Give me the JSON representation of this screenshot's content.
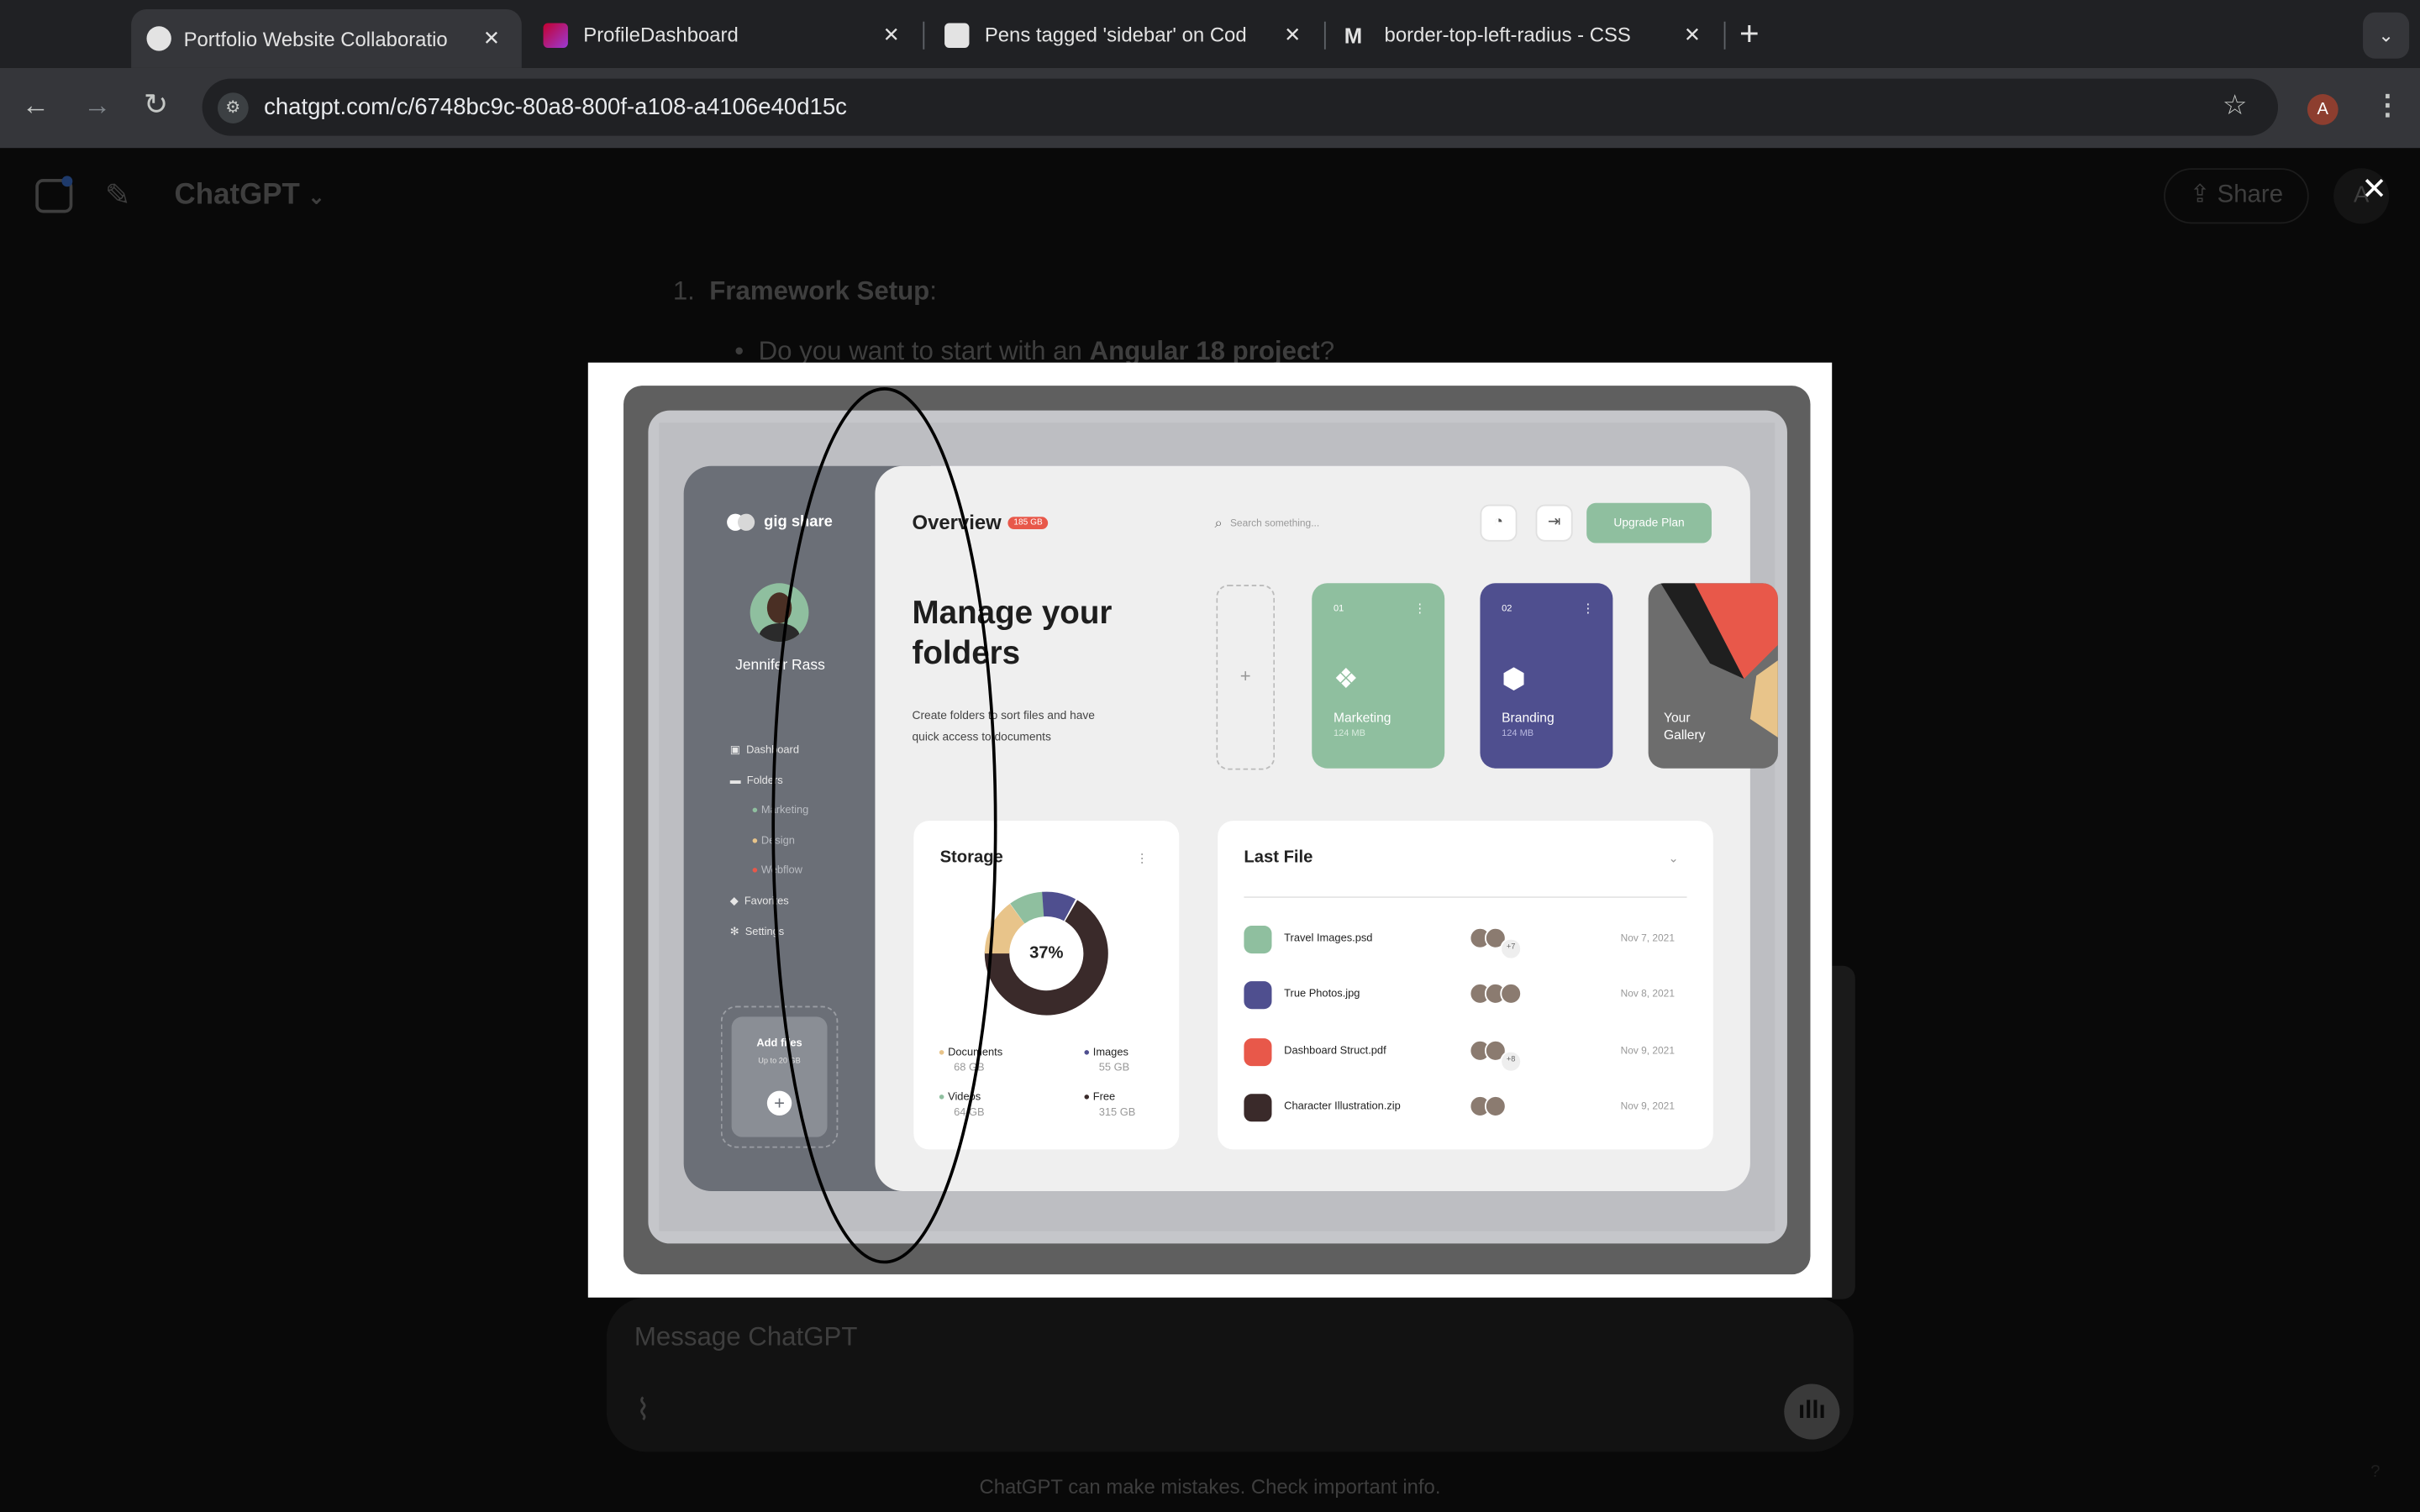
{
  "browser": {
    "tabs": [
      {
        "title": "Portfolio Website Collaboratio",
        "active": true
      },
      {
        "title": "ProfileDashboard",
        "active": false
      },
      {
        "title": "Pens tagged 'sidebar' on Cod",
        "active": false
      },
      {
        "title": "border-top-left-radius - CSS",
        "active": false
      }
    ],
    "new_tab": "+",
    "url": "chatgpt.com/c/6748bc9c-80a8-800f-a108-a4106e40d15c",
    "profile_initial": "A"
  },
  "chatgpt": {
    "title": "ChatGPT",
    "share_label": "Share",
    "avatar_initial": "A",
    "list_number": "1.",
    "list_heading": "Framework Setup",
    "list_colon": ":",
    "bullet_prefix": "Do you want to start with an ",
    "bullet_bold": "Angular 18 project",
    "bullet_suffix": "?",
    "composer_placeholder": "Message ChatGPT",
    "disclaimer": "ChatGPT can make mistakes. Check important info.",
    "help": "?"
  },
  "overlay": {
    "close": "✕"
  },
  "mockup": {
    "brand": "gig share",
    "user_name": "Jennifer Rass",
    "nav": [
      "Dashboard",
      "Folders",
      "Marketing",
      "Design",
      "Webflow",
      "Favorites",
      "Settings"
    ],
    "add_files": "Add files",
    "add_files_sub": "Up to 20 GB",
    "overview": "Overview",
    "overview_badge": "185 GB",
    "search_placeholder": "Search something...",
    "upgrade": "Upgrade Plan",
    "hero_title_1": "Manage your",
    "hero_title_2": "folders",
    "hero_desc_1": "Create folders to sort files and have",
    "hero_desc_2": "quick access to documents",
    "add_symbol": "+",
    "folders": [
      {
        "num": "01",
        "name": "Marketing",
        "size": "124 MB",
        "color": "#8fbf9f"
      },
      {
        "num": "02",
        "name": "Branding",
        "size": "124 MB",
        "color": "#4f4f8f"
      },
      {
        "num": "",
        "name": "Your Gallery",
        "size": "",
        "color": "#6d6d6d"
      }
    ],
    "storage": {
      "title": "Storage",
      "percent": "37%",
      "legend": [
        {
          "label": "Documents",
          "value": "68 GB",
          "color": "#e8c48a"
        },
        {
          "label": "Images",
          "value": "55 GB",
          "color": "#4f4f8f"
        },
        {
          "label": "Videos",
          "value": "64 GB",
          "color": "#8fbf9f"
        },
        {
          "label": "Free",
          "value": "315 GB",
          "color": "#3a2a2a"
        }
      ]
    },
    "last_file": {
      "title": "Last File",
      "files": [
        {
          "name": "Travel Images.psd",
          "extra": "+7",
          "date": "Nov 7, 2021",
          "color": "#8fbf9f"
        },
        {
          "name": "True Photos.jpg",
          "extra": "",
          "date": "Nov 8, 2021",
          "color": "#4f4f8f"
        },
        {
          "name": "Dashboard Struct.pdf",
          "extra": "+8",
          "date": "Nov 9, 2021",
          "color": "#e8584a"
        },
        {
          "name": "Character Illustration.zip",
          "extra": "",
          "date": "Nov 9, 2021",
          "color": "#3a2a2a"
        }
      ]
    }
  }
}
